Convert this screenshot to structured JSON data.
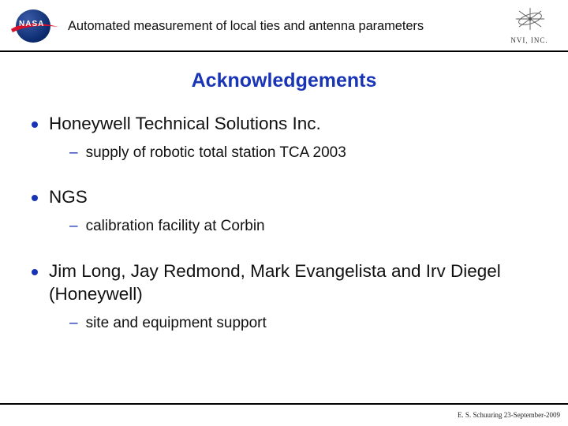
{
  "header": {
    "nasa_label": "NASA",
    "title": "Automated measurement of local ties and antenna parameters",
    "nvi_label": "NVI, INC."
  },
  "slide": {
    "title": "Acknowledgements",
    "items": [
      {
        "text": "Honeywell Technical Solutions Inc.",
        "sub": [
          "supply of robotic total station TCA 2003"
        ]
      },
      {
        "text": "NGS",
        "sub": [
          "calibration facility at Corbin"
        ]
      },
      {
        "text": "Jim Long, Jay Redmond, Mark Evangelista and Irv Diegel (Honeywell)",
        "sub": [
          "site and equipment support"
        ]
      }
    ]
  },
  "footer": {
    "text": "E. S. Schuuring 23-September-2009"
  }
}
